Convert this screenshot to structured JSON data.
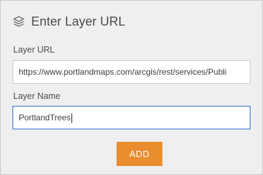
{
  "panel": {
    "title": "Enter Layer URL",
    "icon": "layers-icon"
  },
  "layer_url": {
    "label": "Layer URL",
    "value": "https://www.portlandmaps.com/arcgis/rest/services/Publi"
  },
  "layer_name": {
    "label": "Layer Name",
    "value": "PortlandTrees"
  },
  "add_button": {
    "label": "ADD",
    "color": "#e98d2f"
  },
  "colors": {
    "panel_background": "#efefef",
    "focus_border": "#2e6dd4"
  }
}
